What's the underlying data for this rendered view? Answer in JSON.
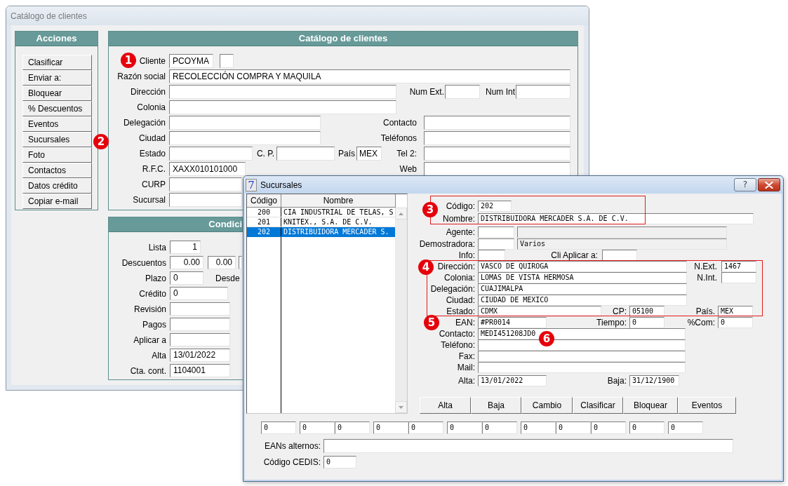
{
  "main_window": {
    "title": "Catálogo de clientes",
    "active": false,
    "actions": {
      "title": "Acciones",
      "buttons": [
        "Clasificar",
        "Enviar a:",
        "Bloquear",
        "% Descuentos",
        "Eventos",
        "Sucursales",
        "Foto",
        "Contactos",
        "Datos crédito",
        "Copiar e-mail"
      ]
    },
    "catalog": {
      "title": "Catálogo de clientes",
      "cliente": {
        "label": "Cliente",
        "value": "PCOYMA"
      },
      "razon_social": {
        "label": "Razón social",
        "value": "RECOLECCIÓN COMPRA Y MAQUILA"
      },
      "direccion": {
        "label": "Dirección"
      },
      "num_ext": {
        "label": "Num Ext."
      },
      "num_int": {
        "label": "Num Int"
      },
      "colonia": {
        "label": "Colonia"
      },
      "delegacion": {
        "label": "Delegación"
      },
      "contacto": {
        "label": "Contacto"
      },
      "ciudad": {
        "label": "Ciudad"
      },
      "telefonos": {
        "label": "Teléfonos"
      },
      "estado": {
        "label": "Estado"
      },
      "cp": {
        "label": "C. P."
      },
      "pais": {
        "label": "País",
        "value": "MEX"
      },
      "tel2": {
        "label": "Tel 2:"
      },
      "rfc": {
        "label": "R.F.C.",
        "value": "XAXX010101000"
      },
      "web": {
        "label": "Web"
      },
      "curp": {
        "label": "CURP"
      },
      "sucursal": {
        "label": "Sucursal"
      }
    },
    "conditions": {
      "title": "Condici",
      "lista": {
        "label": "Lista",
        "value": "1"
      },
      "descuentos": {
        "label": "Descuentos",
        "values": [
          "0.00",
          "0.00"
        ]
      },
      "plazo": {
        "label": "Plazo",
        "value": "0"
      },
      "desde": {
        "label": "Desde"
      },
      "credito": {
        "label": "Crédito",
        "value": "0"
      },
      "revision": {
        "label": "Revisión"
      },
      "pagos": {
        "label": "Pagos"
      },
      "aplicar_a": {
        "label": "Aplicar a"
      },
      "alta": {
        "label": "Alta",
        "value": "13/01/2022"
      },
      "cta_cont": {
        "label": "Cta. cont.",
        "value": "1104001"
      }
    }
  },
  "dialog": {
    "title": "Sucursales",
    "icon_text": "7",
    "active": true,
    "help_button": "?",
    "list": {
      "columns": [
        "Código",
        "Nombre"
      ],
      "rows": [
        {
          "code": "200",
          "name": "CIA INDUSTRIAL DE TELAS, S",
          "selected": false
        },
        {
          "code": "201",
          "name": "KNITEX., S.A. DE C.V.",
          "selected": false
        },
        {
          "code": "202",
          "name": "DISTRIBUIDORA MERCADER S.",
          "selected": true
        }
      ]
    },
    "form": {
      "code_group": {
        "highlighted": true,
        "codigo": {
          "label": "Código:",
          "value": "202"
        },
        "nombre": {
          "label": "Nombre:",
          "value": "DISTRIBUIDORA MERCADER S.A. DE C.V."
        }
      },
      "agente": {
        "label": "Agente:",
        "code": {
          "disabled": false
        },
        "description": {
          "disabled": true
        }
      },
      "demostradora": {
        "label": "Demostradora:",
        "code": {
          "disabled": false
        },
        "description": {
          "value": "Varios",
          "disabled": true
        }
      },
      "info": {
        "label": "Info:"
      },
      "cli_aplicar_a": {
        "label": "Cli Aplicar a:"
      },
      "address_group": {
        "highlighted": true,
        "direccion": {
          "label": "Dirección:",
          "value": "VASCO DE QUIROGA"
        },
        "n_ext": {
          "label": "N.Ext.",
          "value": "1467"
        },
        "colonia": {
          "label": "Colonia:",
          "value": "LOMAS DE VISTA HERMOSA"
        },
        "n_int": {
          "label": "N.Int."
        },
        "delegacion": {
          "label": "Delegación:",
          "value": "CUAJIMALPA"
        },
        "ciudad": {
          "label": "Ciudad:",
          "value": "CIUDAD DE MEXICO"
        },
        "estado": {
          "label": "Estado:",
          "value": "CDMX"
        },
        "cp": {
          "label": "CP:",
          "value": "05100"
        },
        "pais": {
          "label": "País.",
          "value": "MEX"
        }
      },
      "ean": {
        "label": "EAN:",
        "value": "#PR0014"
      },
      "tiempo": {
        "label": "Tiempo:",
        "value": "0"
      },
      "com": {
        "label": "%Com:",
        "value": "0"
      },
      "contacto": {
        "label": "Contacto:",
        "value": "MEDI451208JD0"
      },
      "telefono": {
        "label": "Teléfono:"
      },
      "fax": {
        "label": "Fax:"
      },
      "mail": {
        "label": "Mail:"
      },
      "alta": {
        "label": "Alta:",
        "value": "13/01/2022"
      },
      "baja": {
        "label": "Baja:",
        "value": "31/12/1900"
      }
    },
    "buttons": [
      "Alta",
      "Baja",
      "Cambio",
      "Clasificar",
      "Bloquear",
      "Eventos"
    ],
    "counters": [
      [
        "0"
      ],
      [
        "0",
        "0"
      ],
      [
        "0",
        "0"
      ],
      [
        "0",
        "0"
      ],
      [
        "0",
        "0",
        "0"
      ],
      [
        "0"
      ],
      [
        "0"
      ]
    ],
    "eans_alternos": {
      "label": "EANs alternos:"
    },
    "codigo_cedis": {
      "label": "Código CEDIS:",
      "value": "0"
    }
  },
  "callouts": [
    "1",
    "2",
    "3",
    "4",
    "5",
    "6"
  ]
}
